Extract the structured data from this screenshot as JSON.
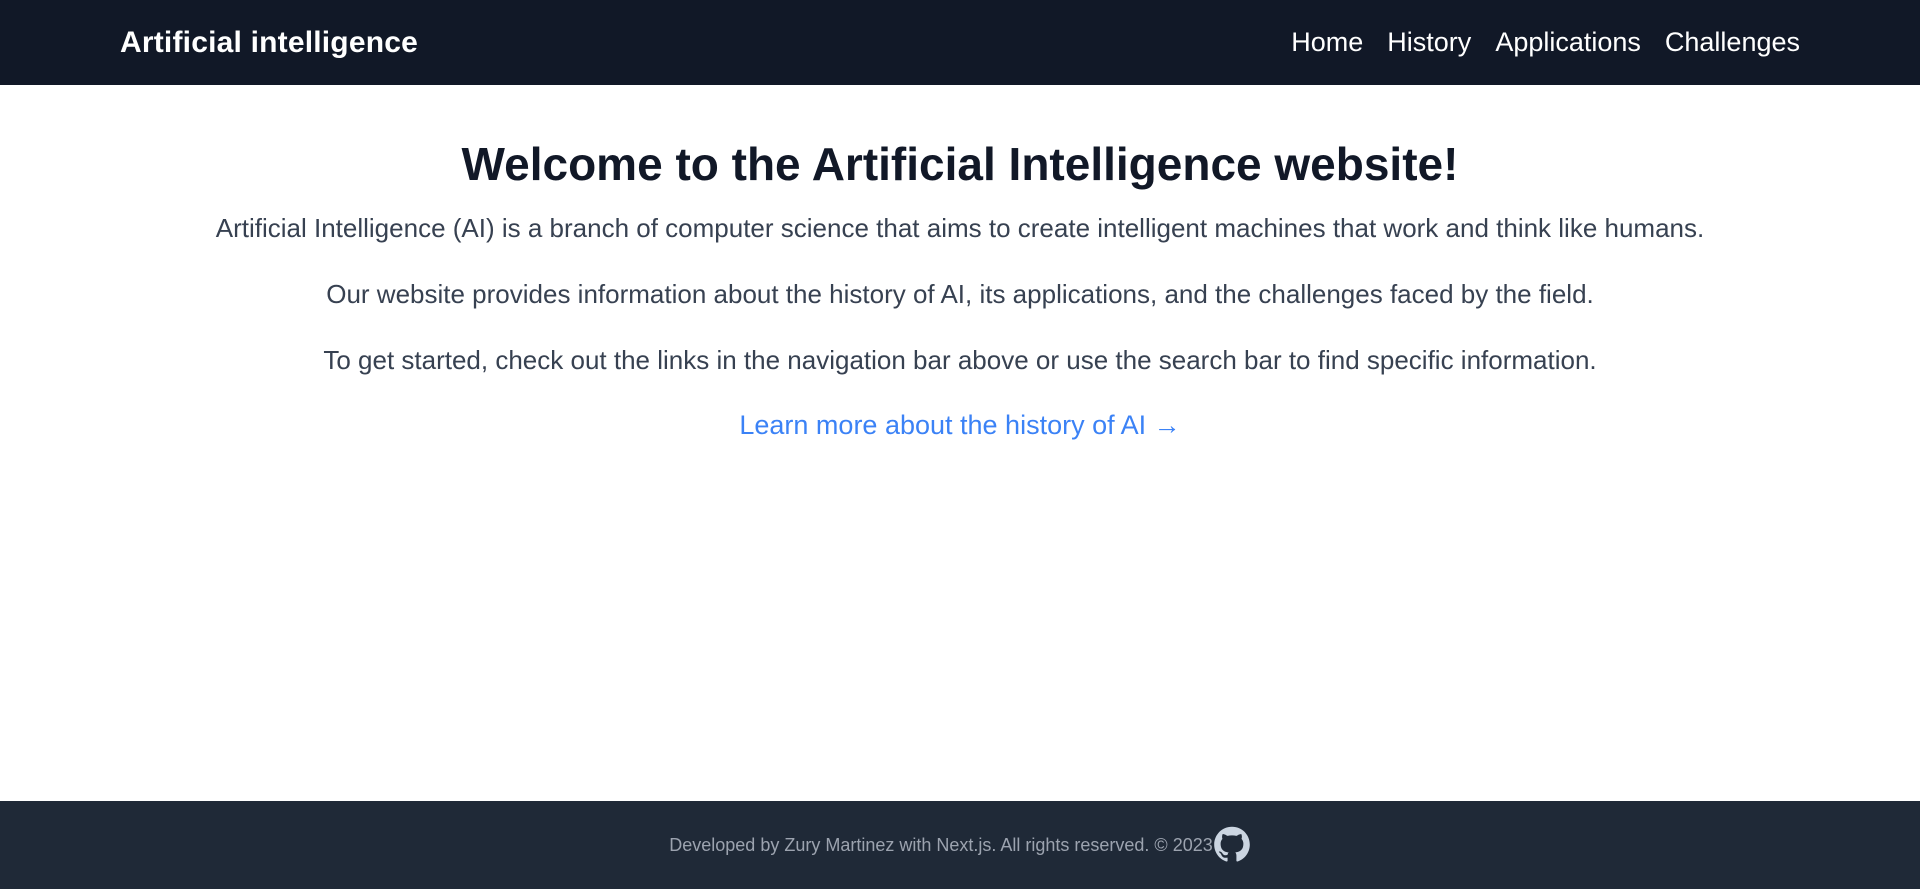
{
  "header": {
    "brand": "Artificial intelligence",
    "nav": [
      {
        "label": "Home"
      },
      {
        "label": "History"
      },
      {
        "label": "Applications"
      },
      {
        "label": "Challenges"
      }
    ]
  },
  "main": {
    "title": "Welcome to the Artificial Intelligence website!",
    "paragraphs": [
      "Artificial Intelligence (AI) is a branch of computer science that aims to create intelligent machines that work and think like humans.",
      "Our website provides information about the history of AI, its applications, and the challenges faced by the field.",
      "To get started, check out the links in the navigation bar above or use the search bar to find specific information."
    ],
    "cta_label": "Learn more about the history of AI →"
  },
  "footer": {
    "text": "Developed by Zury Martinez with Next.js. All rights reserved. © 2023",
    "icon": "github-icon"
  },
  "colors": {
    "topbar": "#111827",
    "footer": "#1f2937",
    "accent": "#3b82f6",
    "title": "#111827",
    "body_text": "#374151",
    "footer_text": "#9ca3af"
  }
}
